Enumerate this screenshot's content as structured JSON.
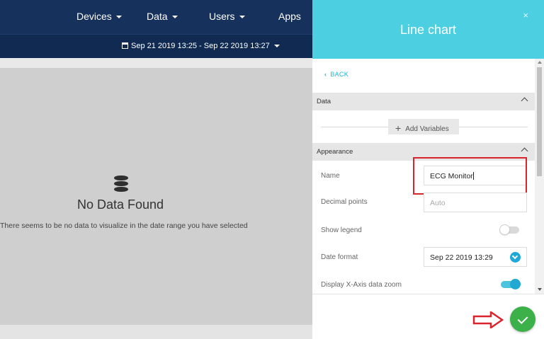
{
  "nav": {
    "items": [
      {
        "label": "Devices",
        "has_caret": true
      },
      {
        "label": "Data",
        "has_caret": true
      },
      {
        "label": "Users",
        "has_caret": true
      },
      {
        "label": "Apps",
        "has_caret": false
      }
    ],
    "date_range": "Sep 21 2019 13:25 - Sep 22 2019 13:27",
    "date_icon": "calendar-icon"
  },
  "main": {
    "empty_icon": "database-icon",
    "title": "No Data Found",
    "subtitle": "There seems to be no data to visualize in the date range you have selected"
  },
  "panel": {
    "title": "Line chart",
    "close": "×",
    "back_label": "BACK",
    "sections": {
      "data_label": "Data",
      "appearance_label": "Appearance"
    },
    "add_variables_label": "Add Variables",
    "fields": {
      "name_label": "Name",
      "name_value": "ECG Monitor",
      "decimal_label": "Decimal points",
      "decimal_placeholder": "Auto",
      "legend_label": "Show legend",
      "legend_on": false,
      "date_format_label": "Date format",
      "date_format_value": "Sep 22 2019 13:29",
      "xzoom_label": "Display X-Axis data zoom",
      "xzoom_on": true
    },
    "confirm_icon": "check-icon"
  },
  "colors": {
    "nav_bg": "#15315c",
    "panel_header": "#4dcfe2",
    "accent": "#1fa8d8",
    "confirm": "#3cb14a",
    "annotation": "#d9252e"
  }
}
